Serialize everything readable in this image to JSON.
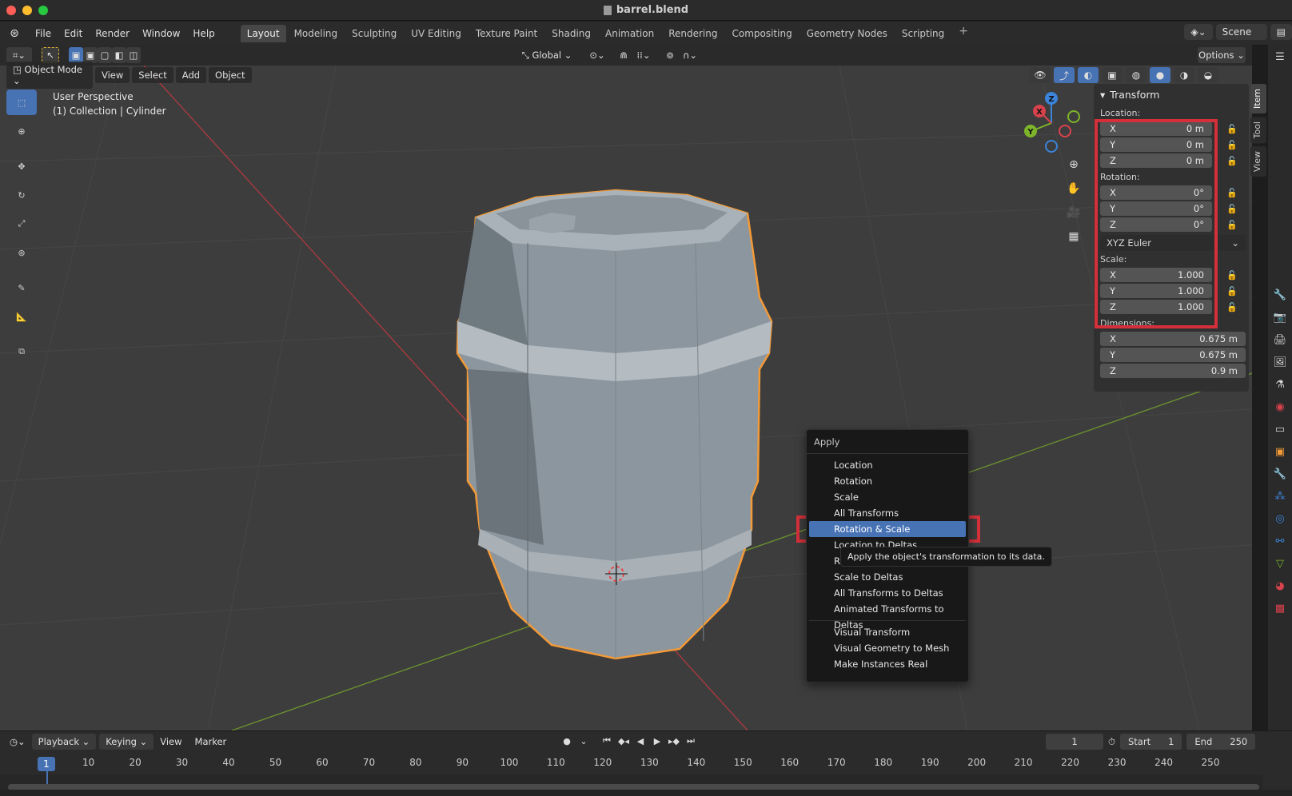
{
  "window": {
    "title": "barrel.blend"
  },
  "menu": {
    "items": [
      "File",
      "Edit",
      "Render",
      "Window",
      "Help"
    ]
  },
  "workspaces": {
    "tabs": [
      "Layout",
      "Modeling",
      "Sculpting",
      "UV Editing",
      "Texture Paint",
      "Shading",
      "Animation",
      "Rendering",
      "Compositing",
      "Geometry Nodes",
      "Scripting"
    ],
    "active": "Layout",
    "add": "+"
  },
  "scene": {
    "label": "Scene"
  },
  "tool_header": {
    "orientation": "Global",
    "options": "Options"
  },
  "viewport_header": {
    "mode": "Object Mode",
    "menus": [
      "View",
      "Select",
      "Add",
      "Object"
    ]
  },
  "viewport": {
    "perspective": "User Perspective",
    "collection": "(1) Collection | Cylinder"
  },
  "gizmo": {
    "x": "X",
    "y": "Y",
    "z": "Z"
  },
  "npanel": {
    "title": "Transform",
    "location_label": "Location:",
    "location": [
      {
        "axis": "X",
        "value": "0 m"
      },
      {
        "axis": "Y",
        "value": "0 m"
      },
      {
        "axis": "Z",
        "value": "0 m"
      }
    ],
    "rotation_label": "Rotation:",
    "rotation": [
      {
        "axis": "X",
        "value": "0°"
      },
      {
        "axis": "Y",
        "value": "0°"
      },
      {
        "axis": "Z",
        "value": "0°"
      }
    ],
    "rotation_mode": "XYZ Euler",
    "scale_label": "Scale:",
    "scale": [
      {
        "axis": "X",
        "value": "1.000"
      },
      {
        "axis": "Y",
        "value": "1.000"
      },
      {
        "axis": "Z",
        "value": "1.000"
      }
    ],
    "dimensions_label": "Dimensions:",
    "dimensions": [
      {
        "axis": "X",
        "value": "0.675 m"
      },
      {
        "axis": "Y",
        "value": "0.675 m"
      },
      {
        "axis": "Z",
        "value": "0.9 m"
      }
    ],
    "tabs": [
      "Item",
      "Tool",
      "View"
    ]
  },
  "apply_menu": {
    "title": "Apply",
    "items_group1": [
      "Location",
      "Rotation",
      "Scale",
      "All Transforms",
      "Rotation & Scale",
      "Location to Deltas",
      "Rotation to Deltas",
      "Scale to Deltas",
      "All Transforms to Deltas",
      "Animated Transforms to Deltas"
    ],
    "highlighted": "Rotation & Scale",
    "items_group2": [
      "Visual Transform",
      "Visual Geometry to Mesh",
      "Make Instances Real"
    ],
    "tooltip": "Apply the object's transformation to its data."
  },
  "timeline": {
    "menus": [
      "Playback",
      "Keying",
      "View",
      "Marker"
    ],
    "current_frame": "1",
    "start_label": "Start",
    "start": "1",
    "end_label": "End",
    "end": "250",
    "ticks": [
      "1",
      "10",
      "20",
      "30",
      "40",
      "50",
      "60",
      "70",
      "80",
      "90",
      "100",
      "110",
      "120",
      "130",
      "140",
      "150",
      "160",
      "170",
      "180",
      "190",
      "200",
      "210",
      "220",
      "230",
      "240",
      "250"
    ]
  },
  "colors": {
    "accent": "#4772b3",
    "highlight_box": "#d4303a",
    "selection_outline": "#f29a38",
    "axis_x": "#d8424c",
    "axis_y": "#7fb52a",
    "axis_z": "#3b84d9"
  }
}
